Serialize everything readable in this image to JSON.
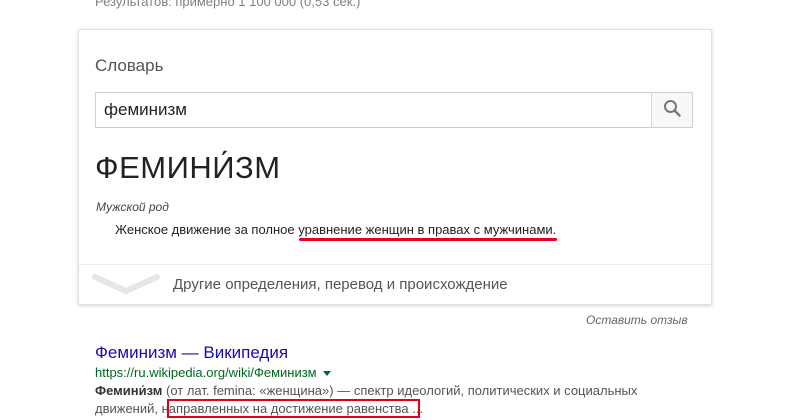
{
  "results_stats": "Результатов: примерно 1 100 000 (0,53 сек.)",
  "dictionary": {
    "title": "Словарь",
    "search_value": "феминизм",
    "search_icon": "magnifier-icon",
    "headword": "ФЕМИНИ́ЗМ",
    "gender": "Мужской род",
    "definition_before": "Женское движение за полное ",
    "definition_highlight": "уравнение женщин в правах с мужчинами",
    "definition_after": ".",
    "more_label": "Другие определения, перевод и происхождение",
    "more_icon": "chevron-down-icon"
  },
  "feedback_label": "Оставить отзыв",
  "result": {
    "title": "Феминизм — Википедия",
    "url": "https://ru.wikipedia.org/wiki/Феминизм",
    "snippet_term": "Фемини́зм",
    "snippet_line1": " (от лат. femina: «женщина») — спектр идеологий, политических и социальных",
    "snippet_line2_pre": "движений, н",
    "snippet_line2_post": "аправленных на достижение равенства ..."
  },
  "colors": {
    "link": "#1a0dab",
    "url": "#006621",
    "annotation_red": "#e0001b"
  }
}
